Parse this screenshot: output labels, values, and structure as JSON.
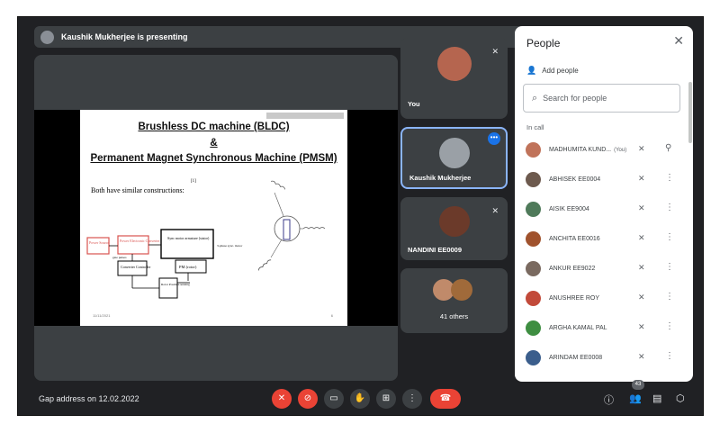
{
  "presenting_banner": "Kaushik Mukherjee is presenting",
  "slide": {
    "title_line1": "Brushless DC machine (BLDC)",
    "title_line2": "&",
    "title_line3": "Permanent Magnet Synchronous Machine (PMSM)",
    "ref_mark": "[1]",
    "body_text": "Both have similar constructions:",
    "diagram_labels": {
      "power_source": "Power Source",
      "converter": "Power Electronic Converter",
      "sync_motor": "Sync motor armature (stator)",
      "phase_note": "3-phase sync. motor",
      "gate_pulses": "gate pulses",
      "controller": "Converter Controller",
      "pm_rotor": "PM (rotor)",
      "rotor_sensing": "Rotor Position sensing"
    },
    "footer_left": "11/11/2021",
    "footer_right": "6"
  },
  "tiles": {
    "you": "You",
    "presenter": "Kaushik Mukherjee",
    "nandini": "NANDINI EE0009",
    "others": "41 others"
  },
  "panel": {
    "title": "People",
    "close_icon": "close-icon",
    "add_people": "Add people",
    "search_placeholder": "Search for people",
    "section_label": "In call",
    "people": [
      {
        "name": "MADHUMITA KUND...",
        "tag": "(You)",
        "avatar_color": "#c0735a",
        "action": "pin-icon"
      },
      {
        "name": "ABHISEK EE0004",
        "tag": "",
        "avatar_color": "#6d5a4e",
        "action": "more-vert-icon"
      },
      {
        "name": "AISIK EE9004",
        "tag": "",
        "avatar_color": "#4f7a5a",
        "action": "more-vert-icon"
      },
      {
        "name": "ANCHITA EE0016",
        "tag": "",
        "avatar_color": "#a0522d",
        "action": "more-vert-icon"
      },
      {
        "name": "ANKUR EE9022",
        "tag": "",
        "avatar_color": "#7a6a60",
        "action": "more-vert-icon"
      },
      {
        "name": "ANUSHREE ROY",
        "tag": "",
        "avatar_color": "#c24a3a",
        "action": "more-vert-icon"
      },
      {
        "name": "ARGHA KAMAL PAL",
        "tag": "",
        "avatar_color": "#3e8e41",
        "action": "more-vert-icon"
      },
      {
        "name": "ARINDAM EE0008",
        "tag": "",
        "avatar_color": "#3b5e8c",
        "action": "more-vert-icon"
      }
    ]
  },
  "bottom": {
    "meeting_title": "Gap address on 12.02.2022",
    "people_count": "43"
  },
  "colors": {
    "background": "#202124",
    "tile": "#3c4043",
    "accent_blue": "#8ab4f8",
    "danger_red": "#ea4335",
    "converter_red": "#d9534f"
  }
}
